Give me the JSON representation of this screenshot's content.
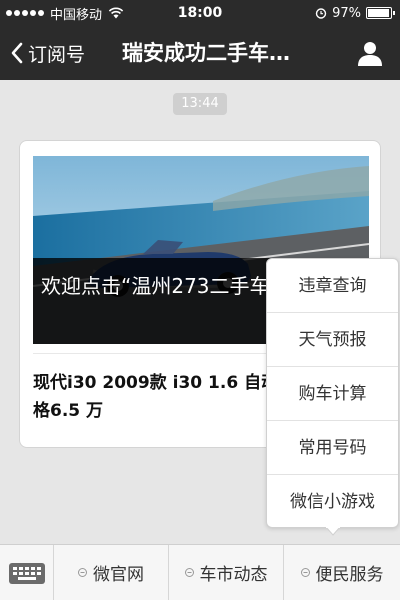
{
  "status_bar": {
    "carrier": "中国移动",
    "time": "18:00",
    "battery": "97%",
    "battery_level": 0.97,
    "signal_strength": 5
  },
  "nav": {
    "back_label": "订阅号",
    "title": "瑞安成功二手车…"
  },
  "chat": {
    "timestamp": "13:44",
    "article": {
      "cover_caption": "欢迎点击“温州273二手车站",
      "subarticle_title": "现代i30 2009款 i30 1.6 自动豪享型　价格6.5 万"
    }
  },
  "popup_menu": {
    "items": [
      {
        "label": "违章查询"
      },
      {
        "label": "天气预报"
      },
      {
        "label": "购车计算"
      },
      {
        "label": "常用号码"
      },
      {
        "label": "微信小游戏"
      }
    ]
  },
  "bottom_menu": {
    "tabs": [
      {
        "label": "微官网"
      },
      {
        "label": "车市动态"
      },
      {
        "label": "便民服务"
      }
    ]
  },
  "icons": {
    "back": "chevron-left-icon",
    "profile": "person-icon",
    "keyboard": "keyboard-icon",
    "wifi": "wifi-icon",
    "alarm": "alarm-clock-icon",
    "menu_dot": "menu-dot-icon"
  },
  "colors": {
    "nav_background": "#2b2b2b",
    "chat_background": "#e6e6e6",
    "timestamp_background": "#cfcfcf"
  }
}
